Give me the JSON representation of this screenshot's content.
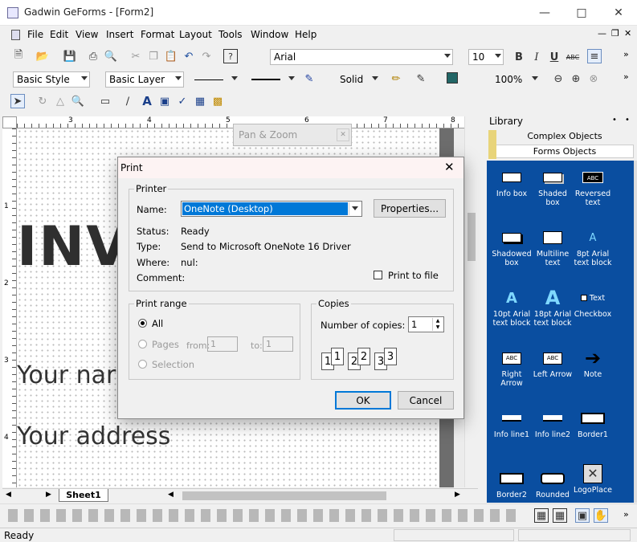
{
  "window": {
    "title": "Gadwin GeForms - [Form2]"
  },
  "menu": [
    "File",
    "Edit",
    "View",
    "Insert",
    "Format",
    "Layout",
    "Tools",
    "Window",
    "Help"
  ],
  "toolbar": {
    "font": "Arial",
    "size": "10",
    "bold": "B",
    "italic": "I",
    "underline": "U",
    "strike": "ABC",
    "style": "Basic Style",
    "layer": "Basic Layer",
    "fill": "Solid",
    "zoom": "100%"
  },
  "ruler": {
    "h": [
      "3",
      "4",
      "5",
      "6",
      "7",
      "8"
    ],
    "v": [
      "1",
      "2",
      "3",
      "4"
    ]
  },
  "canvas": {
    "big_text": "INV",
    "line1": "Your nar",
    "line2": "Your address"
  },
  "panzoom": {
    "title": "Pan & Zoom"
  },
  "sheet": {
    "tab": "Sheet1"
  },
  "library": {
    "title": "Library",
    "tabs": [
      "Complex Objects",
      "Forms Objects"
    ],
    "items": [
      {
        "label": "Info box"
      },
      {
        "label": "Shaded box"
      },
      {
        "label": "Reversed text",
        "sym": "ABC"
      },
      {
        "label": "Shadowed box"
      },
      {
        "label": "Multiline text"
      },
      {
        "label": "8pt Arial text block",
        "sym": "A"
      },
      {
        "label": "10pt Arial text block",
        "sym": "A"
      },
      {
        "label": "18pt Arial text block",
        "sym": "A"
      },
      {
        "label": "Checkbox",
        "sym": "Text"
      },
      {
        "label": "Right Arrow",
        "sym": "ABC"
      },
      {
        "label": "Left Arrow",
        "sym": "ABC"
      },
      {
        "label": "Note"
      },
      {
        "label": "Info line1"
      },
      {
        "label": "Info line2"
      },
      {
        "label": "Border1"
      },
      {
        "label": "Border2"
      },
      {
        "label": "Rounded"
      },
      {
        "label": "LogoPlace"
      }
    ]
  },
  "status": {
    "text": "Ready"
  },
  "dialog": {
    "title": "Print",
    "printer_group": "Printer",
    "name_label": "Name:",
    "name_value": "OneNote (Desktop)",
    "properties": "Properties...",
    "status_label": "Status:",
    "status_value": "Ready",
    "type_label": "Type:",
    "type_value": "Send to Microsoft OneNote 16 Driver",
    "where_label": "Where:",
    "where_value": "nul:",
    "comment_label": "Comment:",
    "print_to_file": "Print to file",
    "range_group": "Print range",
    "all": "All",
    "pages": "Pages",
    "from": "from:",
    "from_value": "1",
    "to": "to:",
    "to_value": "1",
    "selection": "Selection",
    "copies_group": "Copies",
    "copies_label": "Number of copies:",
    "copies_value": "1",
    "collate": [
      "1",
      "1",
      "2",
      "2",
      "3",
      "3"
    ],
    "ok": "OK",
    "cancel": "Cancel"
  }
}
